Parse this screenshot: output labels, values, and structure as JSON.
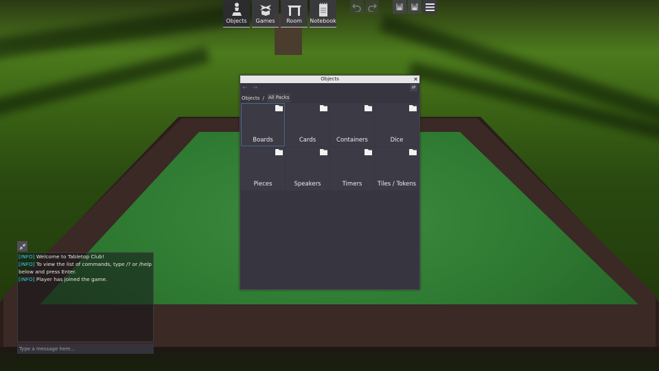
{
  "toolbar": {
    "buttons": [
      {
        "label": "Objects",
        "icon": "pawn-icon",
        "active": true
      },
      {
        "label": "Games",
        "icon": "open-box-icon",
        "active": false
      },
      {
        "label": "Room",
        "icon": "table-icon",
        "active": false
      },
      {
        "label": "Notebook",
        "icon": "notebook-icon",
        "active": false
      }
    ],
    "undo_icon": "undo-icon",
    "redo_icon": "redo-icon",
    "quick_save_icon": "save-icon",
    "quick_load_icon": "load-icon",
    "menu_icon": "menu-icon"
  },
  "objects_window": {
    "title": "Objects",
    "close_glyph": "✕",
    "back_glyph": "←",
    "forward_glyph": "→",
    "swap_glyph": "⇄",
    "breadcrumb": [
      "Objects",
      "All Packs"
    ],
    "breadcrumb_separator": "/",
    "folders": [
      {
        "label": "Boards",
        "selected": true
      },
      {
        "label": "Cards",
        "selected": false
      },
      {
        "label": "Containers",
        "selected": false
      },
      {
        "label": "Dice",
        "selected": false
      },
      {
        "label": "Pieces",
        "selected": false
      },
      {
        "label": "Speakers",
        "selected": false
      },
      {
        "label": "Timers",
        "selected": false
      },
      {
        "label": "Tiles / Tokens",
        "selected": false
      }
    ]
  },
  "chat": {
    "messages": [
      {
        "tag": "[INFO]",
        "text": " Welcome to Tabletop Club!"
      },
      {
        "tag": "[INFO]",
        "text": " To view the list of commands, type /? or /help below and press Enter."
      },
      {
        "tag": "[INFO]",
        "text": " Player has joined the game."
      }
    ],
    "input_placeholder": "Type a message here...",
    "input_value": ""
  },
  "colors": {
    "info_tag": "#2fd2e4",
    "panel_bg": "#37353f",
    "felt": "#2f7a32"
  }
}
